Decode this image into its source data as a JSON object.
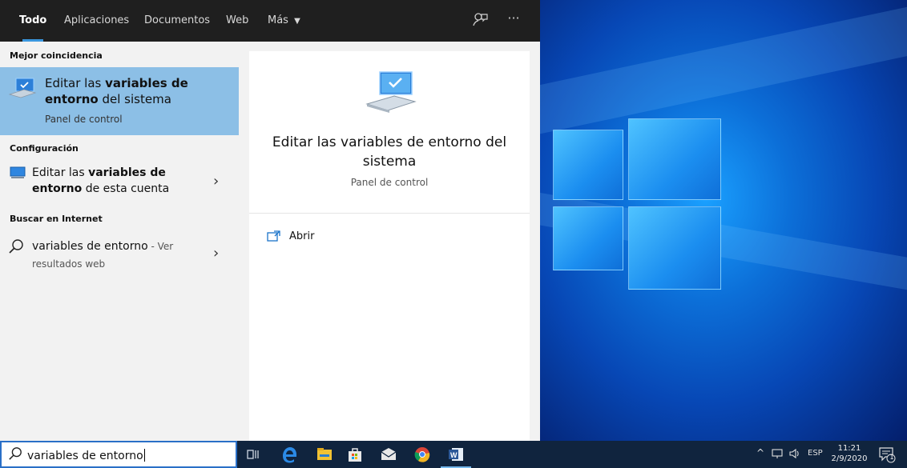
{
  "search_flyout": {
    "tabs": [
      {
        "label": "Todo",
        "active": true
      },
      {
        "label": "Aplicaciones"
      },
      {
        "label": "Documentos"
      },
      {
        "label": "Web"
      },
      {
        "label": "Más"
      }
    ],
    "header_icons": [
      "feedback-icon",
      "more-options-icon"
    ],
    "more_tab_icon": "caret-down-icon",
    "sections": {
      "best_match": "Mejor coincidencia",
      "settings": "Configuración",
      "web": "Buscar en Internet"
    },
    "best_match": {
      "icon": "system-properties-icon",
      "title_parts": [
        {
          "text": "Editar las ",
          "bold": false
        },
        {
          "text": "variables de",
          "bold": true
        },
        {
          "text": " ",
          "bold": false
        },
        {
          "text": "entorno",
          "bold": true
        },
        {
          "text": " del sistema",
          "bold": false
        }
      ],
      "subtitle": "Panel de control"
    },
    "settings_result": {
      "icon": "monitor-icon",
      "title_parts": [
        {
          "text": "Editar las ",
          "bold": false
        },
        {
          "text": "variables de",
          "bold": true
        },
        {
          "text": " ",
          "bold": false
        },
        {
          "text": "entorno",
          "bold": true
        },
        {
          "text": " de esta cuenta",
          "bold": false
        }
      ]
    },
    "web_result": {
      "icon": "search-icon",
      "query": "variables de entorno",
      "suffix": " - Ver",
      "subtitle": "resultados web"
    },
    "preview": {
      "icon": "system-properties-icon",
      "title": "Editar las variables de entorno del sistema",
      "subtitle": "Panel de control",
      "actions": [
        {
          "label": "Abrir",
          "icon": "open-icon"
        }
      ]
    }
  },
  "taskbar": {
    "search": {
      "icon": "search-icon",
      "value": "variables de entorno"
    },
    "pinned": [
      {
        "name": "task-view-icon",
        "color": "#cfd8e3"
      },
      {
        "name": "edge-icon",
        "color": "#2b8ae6"
      },
      {
        "name": "file-explorer-icon",
        "color": "#f2c233"
      },
      {
        "name": "store-icon",
        "color": "#e8e8e8"
      },
      {
        "name": "mail-icon",
        "color": "#e8e8e8"
      },
      {
        "name": "chrome-icon",
        "color": "#f1b423"
      },
      {
        "name": "word-icon",
        "color": "#2b5797"
      }
    ],
    "tray": {
      "language": "ESP",
      "time": "11:21",
      "date": "2/9/2020",
      "notifications": "1"
    }
  },
  "colors": {
    "accent": "#3a96dd",
    "selection": "#8cbfe6",
    "flyout_bg": "#f2f2f2",
    "header_bg": "#1f1f1f",
    "taskbar_bg": "#10243e"
  }
}
